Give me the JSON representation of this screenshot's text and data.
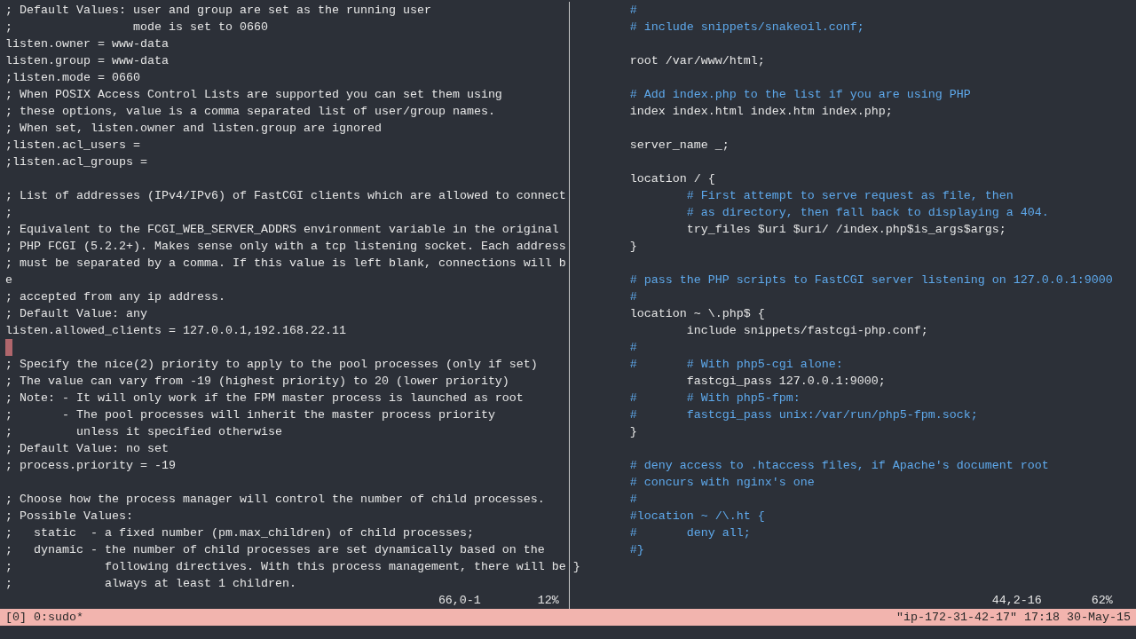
{
  "left_pane": {
    "lines": [
      {
        "text": "; Default Values: user and group are set as the running user",
        "cursor": false
      },
      {
        "text": ";                 mode is set to 0660",
        "cursor": false
      },
      {
        "text": "listen.owner = www-data",
        "cursor": false
      },
      {
        "text": "listen.group = www-data",
        "cursor": false
      },
      {
        "text": ";listen.mode = 0660",
        "cursor": false
      },
      {
        "text": "; When POSIX Access Control Lists are supported you can set them using",
        "cursor": false
      },
      {
        "text": "; these options, value is a comma separated list of user/group names.",
        "cursor": false
      },
      {
        "text": "; When set, listen.owner and listen.group are ignored",
        "cursor": false
      },
      {
        "text": ";listen.acl_users =",
        "cursor": false
      },
      {
        "text": ";listen.acl_groups =",
        "cursor": false
      },
      {
        "cursor": false
      },
      {
        "text": "; List of addresses (IPv4/IPv6) of FastCGI clients which are allowed to connect",
        "cursor": false
      },
      {
        "text": ";",
        "cursor": false
      },
      {
        "text": "; Equivalent to the FCGI_WEB_SERVER_ADDRS environment variable in the original",
        "cursor": false
      },
      {
        "text": "; PHP FCGI (5.2.2+). Makes sense only with a tcp listening socket. Each address",
        "cursor": false
      },
      {
        "text": "; must be separated by a comma. If this value is left blank, connections will b",
        "cursor": false
      },
      {
        "text": "e",
        "cursor": false
      },
      {
        "text": "; accepted from any ip address.",
        "cursor": false
      },
      {
        "text": "; Default Value: any",
        "cursor": false
      },
      {
        "text": "listen.allowed_clients = 127.0.0.1,192.168.22.11",
        "cursor": false
      },
      {
        "cursor": true
      },
      {
        "text": "; Specify the nice(2) priority to apply to the pool processes (only if set)",
        "cursor": false
      },
      {
        "text": "; The value can vary from -19 (highest priority) to 20 (lower priority)",
        "cursor": false
      },
      {
        "text": "; Note: - It will only work if the FPM master process is launched as root",
        "cursor": false
      },
      {
        "text": ";       - The pool processes will inherit the master process priority",
        "cursor": false
      },
      {
        "text": ";         unless it specified otherwise",
        "cursor": false
      },
      {
        "text": "; Default Value: no set",
        "cursor": false
      },
      {
        "text": "; process.priority = -19",
        "cursor": false
      },
      {
        "cursor": false
      },
      {
        "text": "; Choose how the process manager will control the number of child processes.",
        "cursor": false
      },
      {
        "text": "; Possible Values:",
        "cursor": false
      },
      {
        "text": ";   static  - a fixed number (pm.max_children) of child processes;",
        "cursor": false
      },
      {
        "text": ";   dynamic - the number of child processes are set dynamically based on the",
        "cursor": false
      },
      {
        "text": ";             following directives. With this process management, there will be",
        "cursor": false
      },
      {
        "text": ";             always at least 1 children.",
        "cursor": false
      }
    ],
    "position": "66,0-1",
    "percent": "12%"
  },
  "right_pane": {
    "lines": [
      {
        "kind": "comment",
        "text": "        #"
      },
      {
        "kind": "comment",
        "text": "        # include snippets/snakeoil.conf;"
      },
      {
        "kind": "blank"
      },
      {
        "kind": "code",
        "text": "        root /var/www/html;"
      },
      {
        "kind": "blank"
      },
      {
        "kind": "comment",
        "text": "        # Add index.php to the list if you are using PHP"
      },
      {
        "kind": "code",
        "text": "        index index.html index.htm index.php;"
      },
      {
        "kind": "blank"
      },
      {
        "kind": "code",
        "text": "        server_name _;"
      },
      {
        "kind": "blank"
      },
      {
        "kind": "code",
        "text": "        location / {"
      },
      {
        "kind": "comment",
        "text": "                # First attempt to serve request as file, then"
      },
      {
        "kind": "comment",
        "text": "                # as directory, then fall back to displaying a 404."
      },
      {
        "kind": "code",
        "text": "                try_files $uri $uri/ /index.php$is_args$args;"
      },
      {
        "kind": "code",
        "text": "        }"
      },
      {
        "kind": "blank"
      },
      {
        "kind": "comment",
        "text": "        # pass the PHP scripts to FastCGI server listening on 127.0.0.1:9000"
      },
      {
        "kind": "comment",
        "text": "        #"
      },
      {
        "kind": "code",
        "text": "        location ~ \\.php$ {"
      },
      {
        "kind": "code",
        "text": "                include snippets/fastcgi-php.conf;"
      },
      {
        "kind": "comment",
        "text": "        #"
      },
      {
        "kind": "comment",
        "text": "        #       # With php5-cgi alone:"
      },
      {
        "kind": "code",
        "text": "                fastcgi_pass 127.0.0.1:9000;"
      },
      {
        "kind": "comment",
        "text": "        #       # With php5-fpm:"
      },
      {
        "kind": "comment",
        "text": "        #       fastcgi_pass unix:/var/run/php5-fpm.sock;"
      },
      {
        "kind": "code",
        "text": "        }"
      },
      {
        "kind": "blank"
      },
      {
        "kind": "comment",
        "text": "        # deny access to .htaccess files, if Apache's document root"
      },
      {
        "kind": "comment",
        "text": "        # concurs with nginx's one"
      },
      {
        "kind": "comment",
        "text": "        #"
      },
      {
        "kind": "comment",
        "text": "        #location ~ /\\.ht {"
      },
      {
        "kind": "comment",
        "text": "        #       deny all;"
      },
      {
        "kind": "comment",
        "text": "        #}"
      },
      {
        "kind": "code",
        "text": "}"
      },
      {
        "kind": "blank"
      }
    ],
    "position": "44,2-16",
    "percent": "62%"
  },
  "status_bar": {
    "session": "[0]",
    "window": "0:sudo*",
    "host": "\"ip-172-31-42-17\"",
    "time": "17:18",
    "date": "30-May-15"
  }
}
